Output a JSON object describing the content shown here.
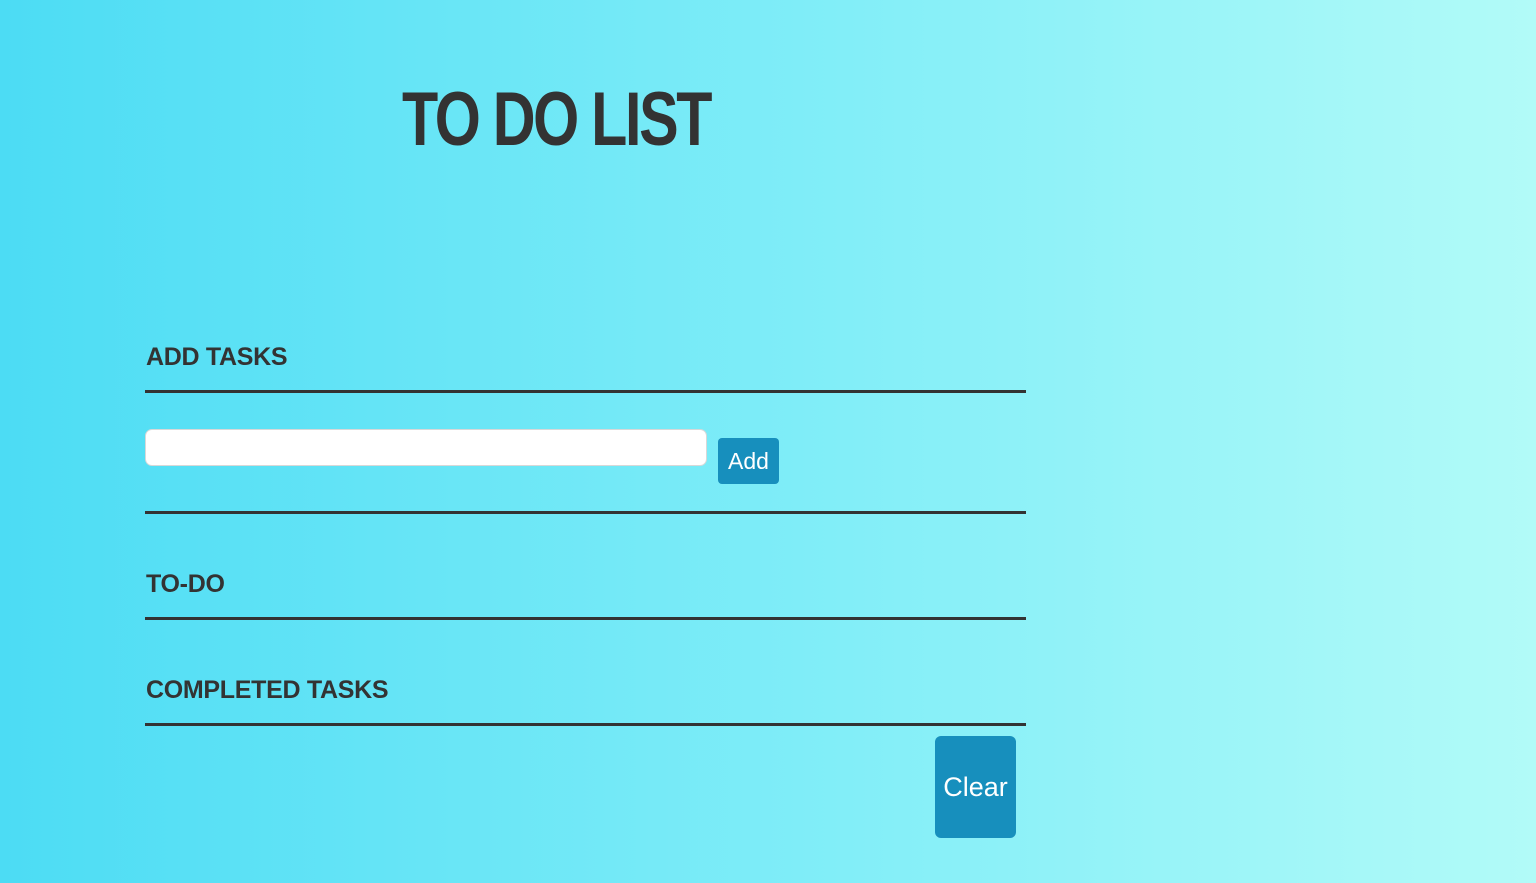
{
  "app": {
    "title": "TO DO LIST"
  },
  "add_section": {
    "heading": "ADD TASKS",
    "input_value": "",
    "input_placeholder": "",
    "add_label": "Add"
  },
  "todo_section": {
    "heading": "TO-DO",
    "items": []
  },
  "completed_section": {
    "heading": "COMPLETED TASKS",
    "items": [],
    "clear_label": "Clear"
  },
  "colors": {
    "background_start": "#4cdcf4",
    "background_end": "#b2fbf8",
    "text": "#333333",
    "button": "#178fbd",
    "button_text": "#ffffff"
  }
}
